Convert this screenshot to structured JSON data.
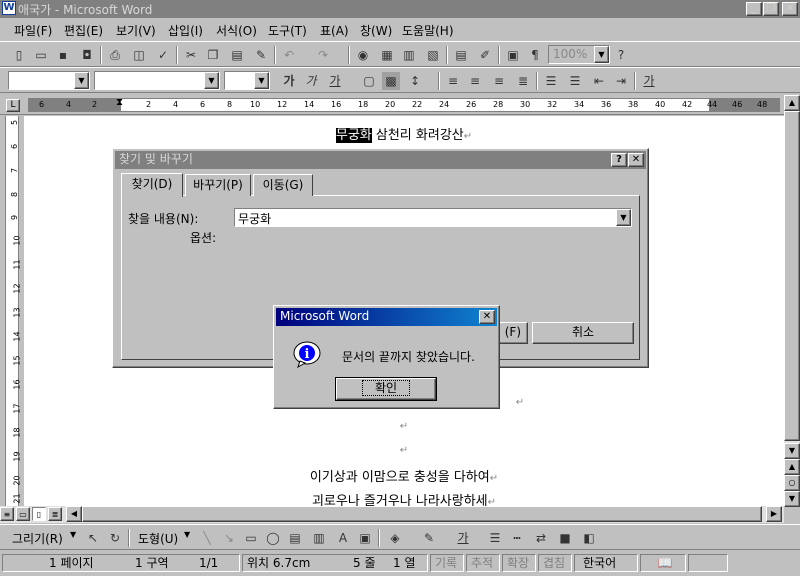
{
  "window": {
    "title": "애국가 - Microsoft Word",
    "app_icon": "W"
  },
  "window_controls": {
    "minimize": "_",
    "restore": "❐",
    "close": "✕"
  },
  "menu": [
    "파일(F)",
    "편집(E)",
    "보기(V)",
    "삽입(I)",
    "서식(O)",
    "도구(T)",
    "표(A)",
    "창(W)",
    "도움말(H)"
  ],
  "standard_toolbar": {
    "zoom": "100%"
  },
  "format_toolbar": {
    "style": "",
    "font": "",
    "size": "",
    "bold_glyph": "가",
    "italic_glyph": "가",
    "underline_glyph": "가"
  },
  "ruler": {
    "ticks": [
      "6",
      "4",
      "2",
      "2",
      "4",
      "6",
      "8",
      "10",
      "12",
      "14",
      "16",
      "18",
      "20",
      "22",
      "24",
      "26",
      "28",
      "30",
      "32",
      "34",
      "36",
      "38",
      "40",
      "42",
      "44",
      "46",
      "48"
    ]
  },
  "vruler": {
    "ticks": [
      "5",
      "6",
      "7",
      "8",
      "9",
      "10",
      "11",
      "12",
      "13",
      "14",
      "15",
      "16",
      "17",
      "18",
      "19",
      "20",
      "21"
    ]
  },
  "document": {
    "line1_selected": "무궁화",
    "line1_rest": " 삼천리 화려강산",
    "line_a": "이기상과 이맘으로 충성을 다하여",
    "line_b": "괴로우나 즐거우나 나라사랑하세",
    "para_mark": "↵"
  },
  "find_dialog": {
    "title": "찾기 및 바꾸기",
    "tabs": [
      "찾기(D)",
      "바꾸기(P)",
      "이동(G)"
    ],
    "find_label": "찾을 내용(N):",
    "find_value": "무궁화",
    "options_label": "옵션:",
    "find_next_partial": "(F)",
    "cancel": "취소",
    "help": "?",
    "close": "✕"
  },
  "alert": {
    "title": "Microsoft Word",
    "message": "문서의 끝까지 찾았습니다.",
    "ok": "확인",
    "close": "✕",
    "icon": "i"
  },
  "draw_toolbar": {
    "draw": "그리기(R)",
    "autoshapes": "도형(U)"
  },
  "status": {
    "page": "1 페이지",
    "section": "1 구역",
    "page_of": "1/1",
    "position": "위치 6.7cm",
    "line": "5 줄",
    "col": "1 열",
    "rec": "기록",
    "trk": "추적",
    "ext": "확장",
    "ovr": "겹침",
    "lang": "한국어"
  }
}
